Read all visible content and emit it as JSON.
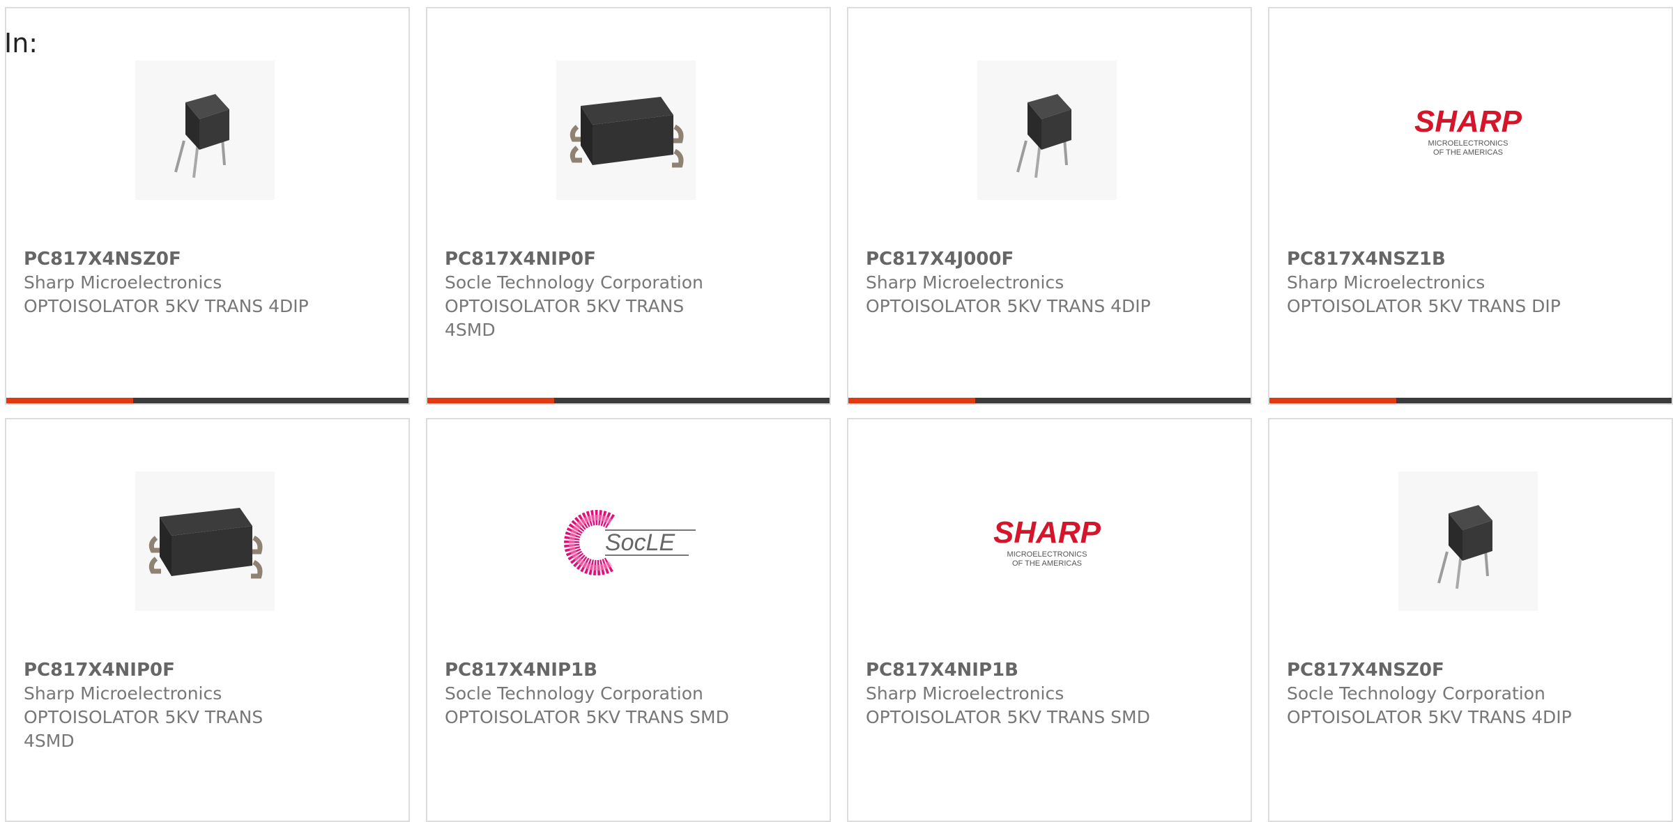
{
  "header": {
    "label": "In:"
  },
  "cards": [
    {
      "part": "PC817X4NSZ0F",
      "manufacturer": "Sharp Microelectronics",
      "description": "OPTOISOLATOR 5KV TRANS 4DIP",
      "image": "dip-package-image"
    },
    {
      "part": "PC817X4NIP0F",
      "manufacturer": "Socle Technology Corporation",
      "description": "OPTOISOLATOR 5KV TRANS 4SMD",
      "image": "smd-package-image"
    },
    {
      "part": "PC817X4J000F",
      "manufacturer": "Sharp Microelectronics",
      "description": "OPTOISOLATOR 5KV TRANS 4DIP",
      "image": "dip-package-image"
    },
    {
      "part": "PC817X4NSZ1B",
      "manufacturer": "Sharp Microelectronics",
      "description": "OPTOISOLATOR 5KV TRANS DIP",
      "image": "sharp-logo",
      "logo_text": "SHARP",
      "logo_sub1": "MICROELECTRONICS",
      "logo_sub2": "OF THE AMERICAS"
    },
    {
      "part": "PC817X4NIP0F",
      "manufacturer": "Sharp Microelectronics",
      "description": "OPTOISOLATOR 5KV TRANS 4SMD",
      "image": "smd-package-image"
    },
    {
      "part": "PC817X4NIP1B",
      "manufacturer": "Socle Technology Corporation",
      "description": "OPTOISOLATOR 5KV TRANS SMD",
      "image": "socle-logo",
      "logo_text": "SocLE"
    },
    {
      "part": "PC817X4NIP1B",
      "manufacturer": "Sharp Microelectronics",
      "description": "OPTOISOLATOR 5KV TRANS SMD",
      "image": "sharp-logo",
      "logo_text": "SHARP",
      "logo_sub1": "MICROELECTRONICS",
      "logo_sub2": "OF THE AMERICAS"
    },
    {
      "part": "PC817X4NSZ0F",
      "manufacturer": "Socle Technology Corporation",
      "description": "OPTOISOLATOR 5KV TRANS 4DIP",
      "image": "dip-package-image"
    }
  ],
  "colors": {
    "accent": "#e03a12",
    "bar": "#3b3b3b",
    "border": "#dcdcdc",
    "text": "#666666",
    "sharp_red": "#d5152a",
    "socle_pink": "#e0107a"
  }
}
